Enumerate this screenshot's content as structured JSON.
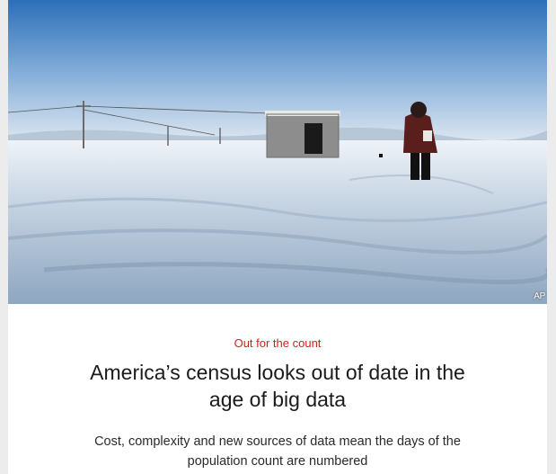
{
  "article": {
    "image_credit": "AP",
    "kicker": "Out for the count",
    "headline": "America’s census looks out of date in the age of big data",
    "standfirst": "Cost, complexity and new sources of data mean the days of the population count are numbered"
  },
  "colors": {
    "kicker": "#d51c1c",
    "headline": "#1b1b1b",
    "background": "#ececec",
    "card": "#ffffff"
  }
}
